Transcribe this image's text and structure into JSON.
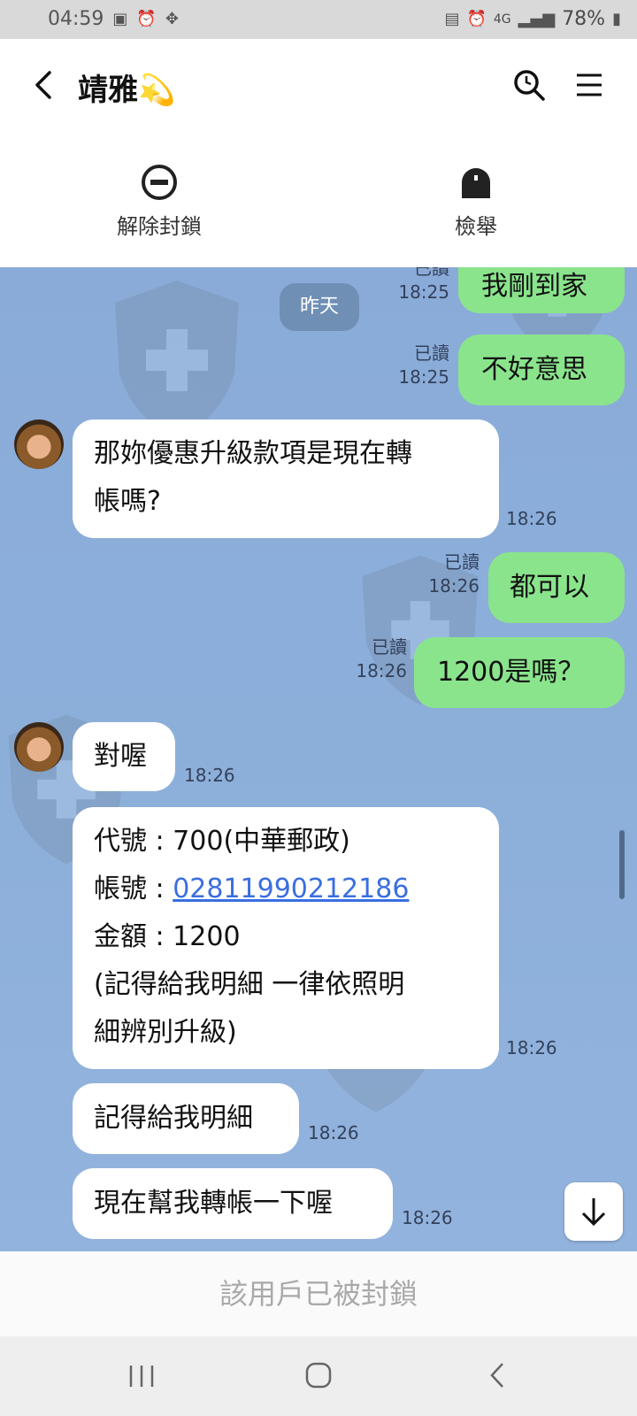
{
  "status_bar": {
    "time": "04:59",
    "network": "4G",
    "battery": "78%"
  },
  "header": {
    "title": "靖雅💫",
    "unblock_label": "解除封鎖",
    "report_label": "檢舉"
  },
  "chat": {
    "date_label": "昨天",
    "read_label": "已讀",
    "messages": [
      {
        "text": "我剛到家",
        "time": "18:25"
      },
      {
        "text": "不好意思",
        "time": "18:25"
      },
      {
        "text_line1": "那妳優惠升級款項是現在轉",
        "text_line2": "帳嗎?",
        "time": "18:26"
      },
      {
        "text": "都可以",
        "time": "18:26"
      },
      {
        "text": "1200是嗎？",
        "time": "18:26"
      },
      {
        "text": "對喔",
        "time": "18:26"
      },
      {
        "line1": "代號 : 700(中華郵政)",
        "line2_prefix": "帳號 : ",
        "account": "02811990212186",
        "line3": "金額 : 1200",
        "line4": "(記得給我明細 一律依照明",
        "line5": "細辨別升級)",
        "time": "18:26"
      },
      {
        "text": "記得給我明細",
        "time": "18:26"
      },
      {
        "text": "現在幫我轉帳一下喔",
        "time": "18:26"
      }
    ]
  },
  "blocked_notice": "該用戶已被封鎖",
  "icons": {
    "back": "chevron-left-icon",
    "search": "search-icon",
    "menu": "hamburger-icon",
    "unblock": "minus-circle-icon",
    "report": "bell-icon",
    "scroll_down": "arrow-down-icon"
  },
  "colors": {
    "chat_bg": "#8db0db",
    "outgoing_bubble": "#8ae48c",
    "incoming_bubble": "#ffffff",
    "link": "#3a6ee0"
  }
}
